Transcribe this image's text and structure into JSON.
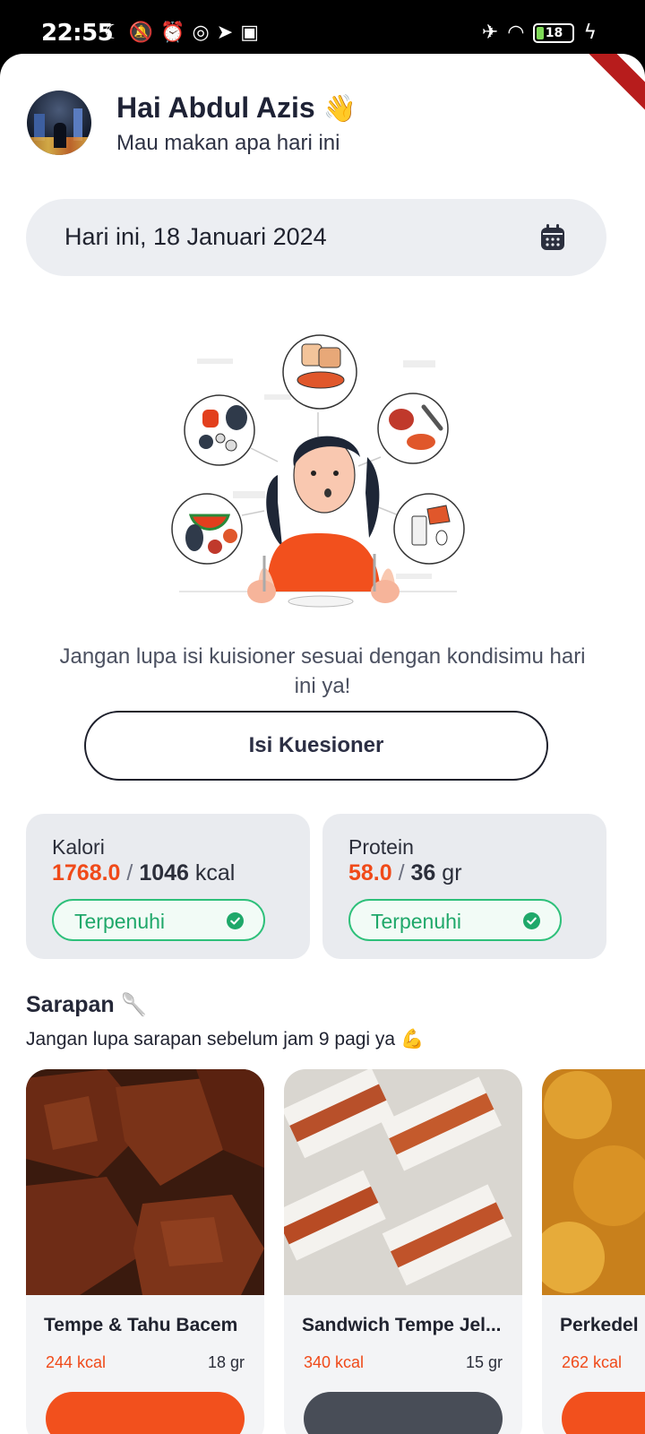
{
  "status_bar": {
    "time": "22:55",
    "left_icons": [
      "moon-icon",
      "bell-off-icon",
      "alarm-icon",
      "whatsapp-icon",
      "telegram-icon",
      "app-icon"
    ],
    "right_icons": [
      "airplane-icon",
      "wifi-icon",
      "battery-icon",
      "charging-icon"
    ],
    "battery_level": "18"
  },
  "header": {
    "greeting": "Hai Abdul Azis",
    "wave_emoji": "👋",
    "subtitle": "Mau makan apa hari ini"
  },
  "date_picker": {
    "label": "Hari ini, 18 Januari 2024",
    "icon": "calendar-icon"
  },
  "questionnaire": {
    "prompt": "Jangan lupa isi kuisioner sesuai dengan kondisimu hari ini ya!",
    "button_label": "Isi Kuesioner"
  },
  "stats": [
    {
      "label": "Kalori",
      "current": "1768.0",
      "separator": "/",
      "target": "1046",
      "unit": "kcal",
      "status": "Terpenuhi"
    },
    {
      "label": "Protein",
      "current": "58.0",
      "separator": "/",
      "target": "36",
      "unit": "gr",
      "status": "Terpenuhi"
    }
  ],
  "breakfast": {
    "title": "Sarapan",
    "title_icon": "🥄",
    "subtitle": "Jangan lupa sarapan sebelum jam 9 pagi ya",
    "subtitle_icon": "💪",
    "items": [
      {
        "name": "Tempe & Tahu Bacem",
        "kcal": "244 kcal",
        "protein": "18 gr",
        "button_color": "#f2501d"
      },
      {
        "name": "Sandwich Tempe Jel...",
        "kcal": "340 kcal",
        "protein": "15 gr",
        "button_color": "#484d57"
      },
      {
        "name": "Perkedel",
        "kcal": "262 kcal",
        "protein": "",
        "button_color": "#f2501d"
      }
    ]
  },
  "colors": {
    "accent": "#f04a19",
    "success": "#2ec07a",
    "card_bg": "#e9ebef"
  }
}
